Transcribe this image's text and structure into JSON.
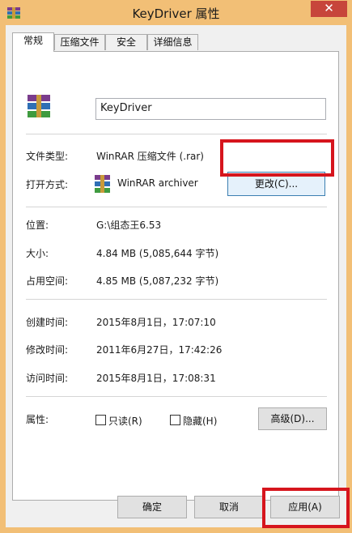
{
  "window": {
    "title": "KeyDriver 属性",
    "close_label": "✕",
    "accent": "#f2bf76",
    "close_color": "#c7453b",
    "highlight_color": "#d6151d"
  },
  "tabs": [
    "常规",
    "压缩文件",
    "安全",
    "详细信息"
  ],
  "file": {
    "name": "KeyDriver",
    "type_label": "文件类型:",
    "type_value": "WinRAR 压缩文件 (.rar)",
    "open_label": "打开方式:",
    "open_value": "WinRAR archiver",
    "change_button": "更改(C)..."
  },
  "location": {
    "location_label": "位置:",
    "location_value": "G:\\组态王6.53",
    "size_label": "大小:",
    "size_value": "4.84 MB (5,085,644 字节)",
    "disk_label": "占用空间:",
    "disk_value": "4.85 MB (5,087,232 字节)"
  },
  "times": {
    "created_label": "创建时间:",
    "created_value": "2015年8月1日，17:07:10",
    "modified_label": "修改时间:",
    "modified_value": "2011年6月27日，17:42:26",
    "accessed_label": "访问时间:",
    "accessed_value": "2015年8月1日，17:08:31"
  },
  "attributes": {
    "label": "属性:",
    "readonly": "只读(R)",
    "hidden": "隐藏(H)",
    "advanced_button": "高级(D)..."
  },
  "footer": {
    "ok": "确定",
    "cancel": "取消",
    "apply": "应用(A)"
  },
  "icons": {
    "app": "winrar-archive-icon",
    "file": "winrar-archive-icon",
    "open_with": "winrar-app-icon"
  }
}
